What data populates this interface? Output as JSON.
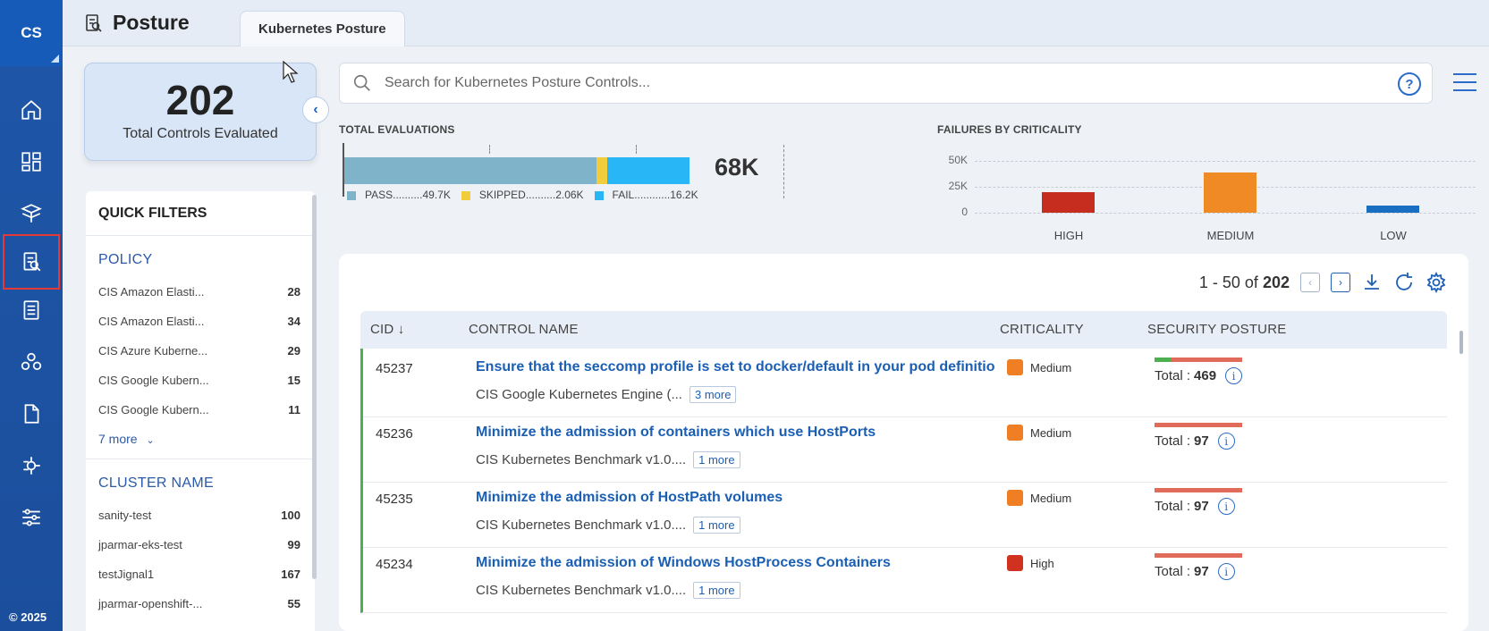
{
  "rail": {
    "user_initials": "CS",
    "items": [
      {
        "name": "home-icon"
      },
      {
        "name": "dashboard-icon"
      },
      {
        "name": "cube-stack-icon"
      },
      {
        "name": "posture-icon"
      },
      {
        "name": "report-icon"
      },
      {
        "name": "network-icon"
      },
      {
        "name": "file-icon"
      },
      {
        "name": "connector-icon"
      },
      {
        "name": "settings-sliders-icon"
      }
    ],
    "copyright": "© 2025"
  },
  "header": {
    "title": "Posture",
    "tab": "Kubernetes Posture"
  },
  "summary": {
    "total": "202",
    "total_label": "Total Controls Evaluated"
  },
  "search": {
    "placeholder": "Search for Kubernetes Posture Controls..."
  },
  "quick_filters": {
    "title": "QUICK FILTERS",
    "policy_title": "POLICY",
    "policies": [
      {
        "label": "CIS Amazon Elasti...",
        "count": "28"
      },
      {
        "label": "CIS Amazon Elasti...",
        "count": "34"
      },
      {
        "label": "CIS Azure Kuberne...",
        "count": "29"
      },
      {
        "label": "CIS Google Kubern...",
        "count": "15"
      },
      {
        "label": "CIS Google Kubern...",
        "count": "11"
      }
    ],
    "more_label": "7 more",
    "cluster_title": "CLUSTER NAME",
    "clusters": [
      {
        "label": "sanity-test",
        "count": "100"
      },
      {
        "label": "jparmar-eks-test",
        "count": "99"
      },
      {
        "label": "testJignal1",
        "count": "167"
      },
      {
        "label": "jparmar-openshift-...",
        "count": "55"
      }
    ]
  },
  "total_evaluations": {
    "title": "TOTAL EVALUATIONS",
    "total": "68K",
    "segments": [
      {
        "label": "PASS..........49.7K",
        "value": 49.7,
        "color": "#7fb3c9"
      },
      {
        "label": "SKIPPED..........2.06K",
        "value": 2.06,
        "color": "#f2cd3b"
      },
      {
        "label": "FAIL............16.2K",
        "value": 16.2,
        "color": "#29b6f6"
      }
    ]
  },
  "chart_data": {
    "type": "bar",
    "title": "FAILURES BY CRITICALITY",
    "categories": [
      "HIGH",
      "MEDIUM",
      "LOW"
    ],
    "values": [
      20000,
      39000,
      7000
    ],
    "colors": [
      "#c62d1f",
      "#f08a24",
      "#1a6ec2"
    ],
    "yticks": [
      "50K",
      "25K",
      "0"
    ],
    "ylim": [
      0,
      50000
    ],
    "grid": true
  },
  "table": {
    "pager_range": "1 - 50 of",
    "pager_total": "202",
    "columns": [
      "CID ↓",
      "CONTROL NAME",
      "CRITICALITY",
      "SECURITY POSTURE"
    ],
    "rows": [
      {
        "cid": "45237",
        "name": "Ensure that the seccomp profile is set to docker/default in your pod definitions",
        "policy": "CIS Google Kubernetes Engine (...",
        "more": "3 more",
        "criticality": "Medium",
        "crit_color": "#f07f23",
        "total_label": "Total :",
        "total": "469",
        "pass_fraction": 0.18
      },
      {
        "cid": "45236",
        "name": "Minimize the admission of containers which use HostPorts",
        "policy": "CIS Kubernetes Benchmark v1.0....",
        "more": "1 more",
        "criticality": "Medium",
        "crit_color": "#f07f23",
        "total_label": "Total :",
        "total": "97",
        "pass_fraction": 0
      },
      {
        "cid": "45235",
        "name": "Minimize the admission of HostPath volumes",
        "policy": "CIS Kubernetes Benchmark v1.0....",
        "more": "1 more",
        "criticality": "Medium",
        "crit_color": "#f07f23",
        "total_label": "Total :",
        "total": "97",
        "pass_fraction": 0
      },
      {
        "cid": "45234",
        "name": "Minimize the admission of Windows HostProcess Containers",
        "policy": "CIS Kubernetes Benchmark v1.0....",
        "more": "1 more",
        "criticality": "High",
        "crit_color": "#d1321f",
        "total_label": "Total :",
        "total": "97",
        "pass_fraction": 0
      }
    ]
  }
}
